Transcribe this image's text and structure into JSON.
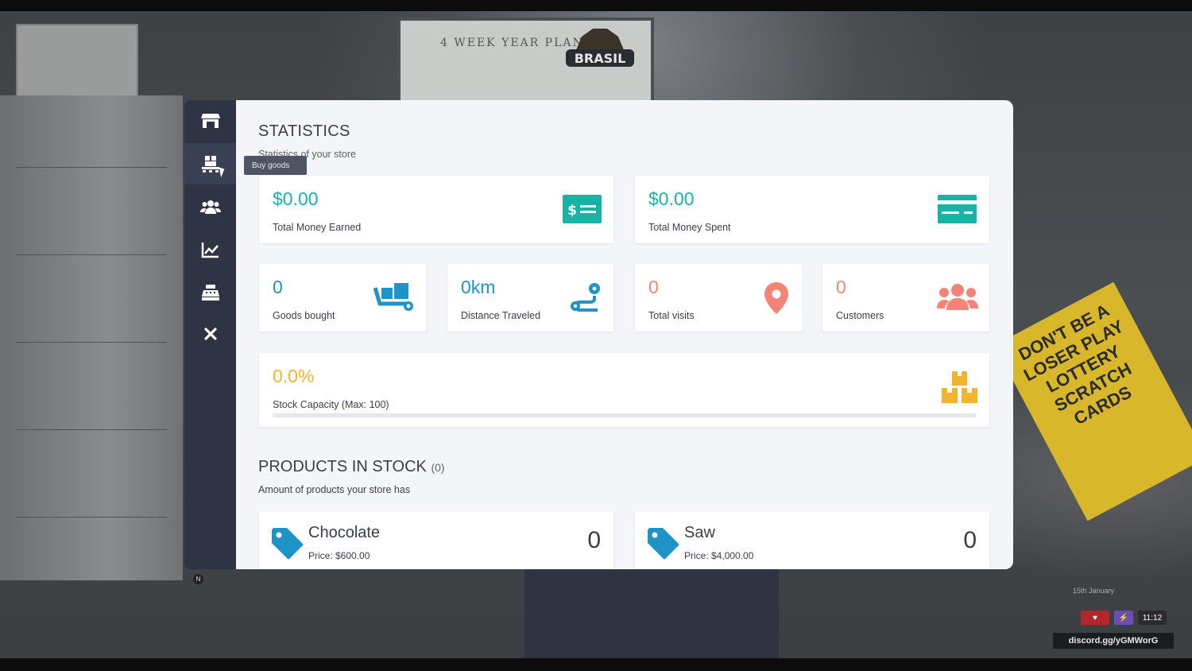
{
  "sidebar": {
    "items": [
      {
        "name": "store",
        "icon": "store-icon"
      },
      {
        "name": "buy-goods",
        "icon": "pallet-icon",
        "active": true
      },
      {
        "name": "employees",
        "icon": "users-icon"
      },
      {
        "name": "statistics",
        "icon": "chart-line-icon"
      },
      {
        "name": "cash-register",
        "icon": "cash-register-icon"
      },
      {
        "name": "close",
        "icon": "close-icon"
      }
    ],
    "tooltip": "Buy goods"
  },
  "statistics": {
    "title": "STATISTICS",
    "subtitle": "Statistics of your store",
    "money_earned": {
      "value": "$0.00",
      "label": "Total Money Earned"
    },
    "money_spent": {
      "value": "$0.00",
      "label": "Total Money Spent"
    },
    "goods_bought": {
      "value": "0",
      "label": "Goods bought"
    },
    "distance": {
      "value": "0km",
      "label": "Distance Traveled"
    },
    "visits": {
      "value": "0",
      "label": "Total visits"
    },
    "customers": {
      "value": "0",
      "label": "Customers"
    },
    "stock": {
      "value": "0.0%",
      "label": "Stock Capacity (Max: 100)",
      "percent": 0.0
    }
  },
  "products": {
    "title": "PRODUCTS IN STOCK",
    "count": "(0)",
    "subtitle": "Amount of products your store has",
    "items": [
      {
        "name": "Chocolate",
        "price": "Price: $600.00",
        "qty": "0"
      },
      {
        "name": "Saw",
        "price": "Price: $4,000.00",
        "qty": "0"
      }
    ]
  },
  "hud": {
    "date": "15th January",
    "time": "11:12",
    "discord": "discord.gg/yGMWorG",
    "compass": "N"
  },
  "background": {
    "logo_text": "BRASIL",
    "board_text": "4 WEEK YEAR PLAN",
    "sign_text": "DON'T BE A LOSER PLAY LOTTERY SCRATCH CARDS"
  },
  "colors": {
    "teal": "#17b4a6",
    "blue": "#1d93c7",
    "coral": "#f48576",
    "gold": "#f1b42f",
    "sidebar": "#2f3445",
    "panel": "#f4f5f9"
  }
}
